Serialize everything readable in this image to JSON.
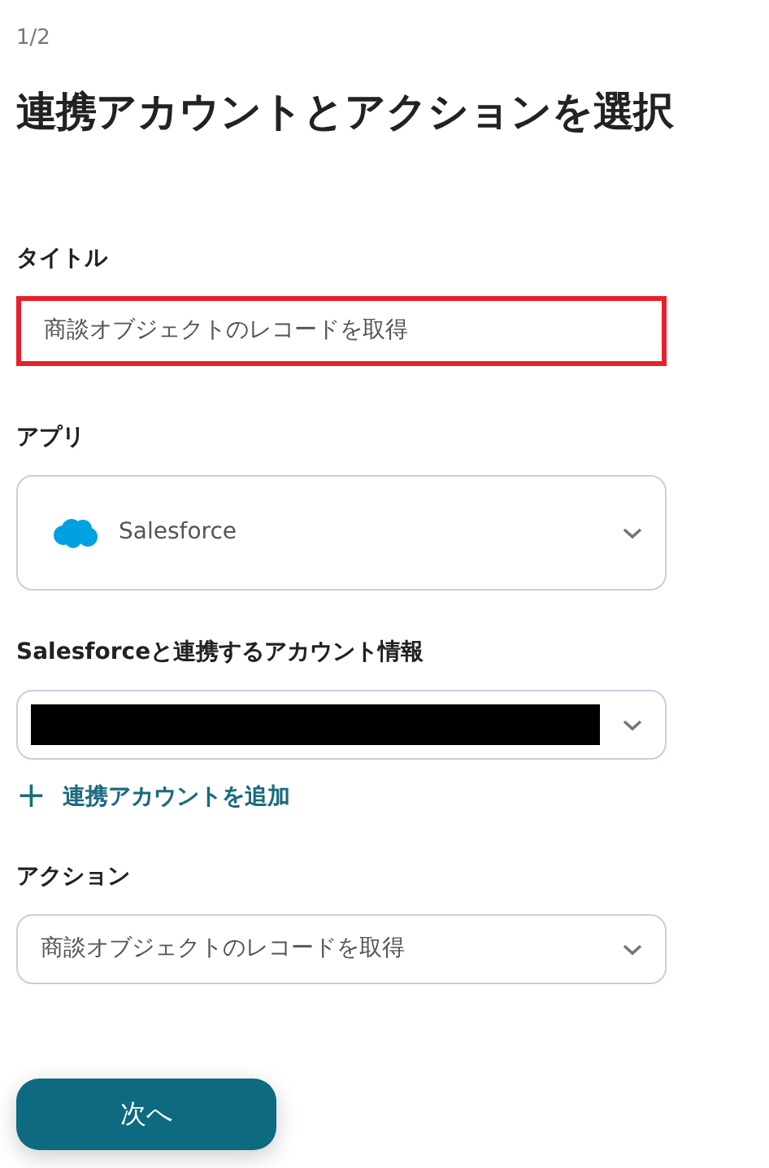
{
  "step": "1/2",
  "heading": "連携アカウントとアクションを選択",
  "title_field": {
    "label": "タイトル",
    "value": "商談オブジェクトのレコードを取得",
    "highlighted": true
  },
  "app_select": {
    "label": "アプリ",
    "value": "Salesforce"
  },
  "account_select": {
    "label": "Salesforceと連携するアカウント情報",
    "redacted": true
  },
  "add_account": {
    "icon": "+",
    "label": "連携アカウントを追加"
  },
  "action_select": {
    "label": "アクション",
    "value": "商談オブジェクトのレコードを取得"
  },
  "next_button": "次へ"
}
